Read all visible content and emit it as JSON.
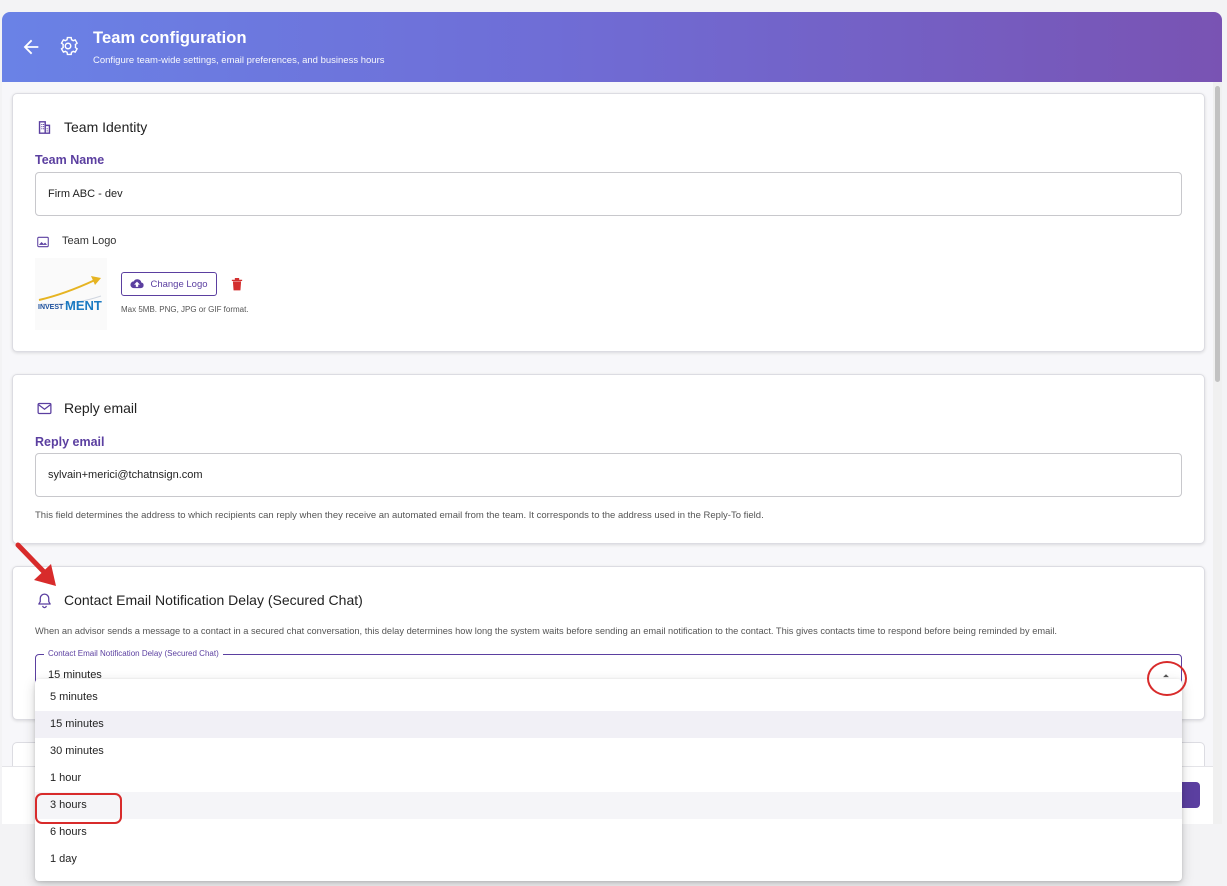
{
  "header": {
    "title": "Team configuration",
    "subtitle": "Configure team-wide settings, email preferences, and business hours",
    "back_icon": "arrow-left-icon",
    "settings_icon": "gear-icon"
  },
  "identity": {
    "section_title": "Team Identity",
    "team_name_label": "Team Name",
    "team_name_value": "Firm ABC - dev",
    "logo_label": "Team Logo",
    "change_logo_label": "Change Logo",
    "logo_hint": "Max 5MB. PNG, JPG or GIF format.",
    "logo_text_a": "INVEST",
    "logo_text_b": "MENT"
  },
  "reply": {
    "section_title": "Reply email",
    "field_label": "Reply email",
    "field_value": "sylvain+merici@tchatnsign.com",
    "help_text": "This field determines the address to which recipients can reply when they receive an automated email from the team. It corresponds to the address used in the Reply-To field."
  },
  "notification": {
    "section_title": "Contact Email Notification Delay (Secured Chat)",
    "description": "When an advisor sends a message to a contact in a secured chat conversation, this delay determines how long the system waits before sending an email notification to the contact. This gives contacts time to respond before being reminded by email.",
    "select_legend": "Contact Email Notification Delay (Secured Chat)",
    "select_value": "15 minutes",
    "options": [
      "5 minutes",
      "15 minutes",
      "30 minutes",
      "1 hour",
      "3 hours",
      "6 hours",
      "1 day"
    ],
    "selected_index": 1,
    "highlighted_index": 4
  },
  "colors": {
    "accent": "#5b3fa0",
    "annotation": "#d82b2b",
    "header_start": "#6a82e6",
    "header_end": "#7953b3"
  }
}
